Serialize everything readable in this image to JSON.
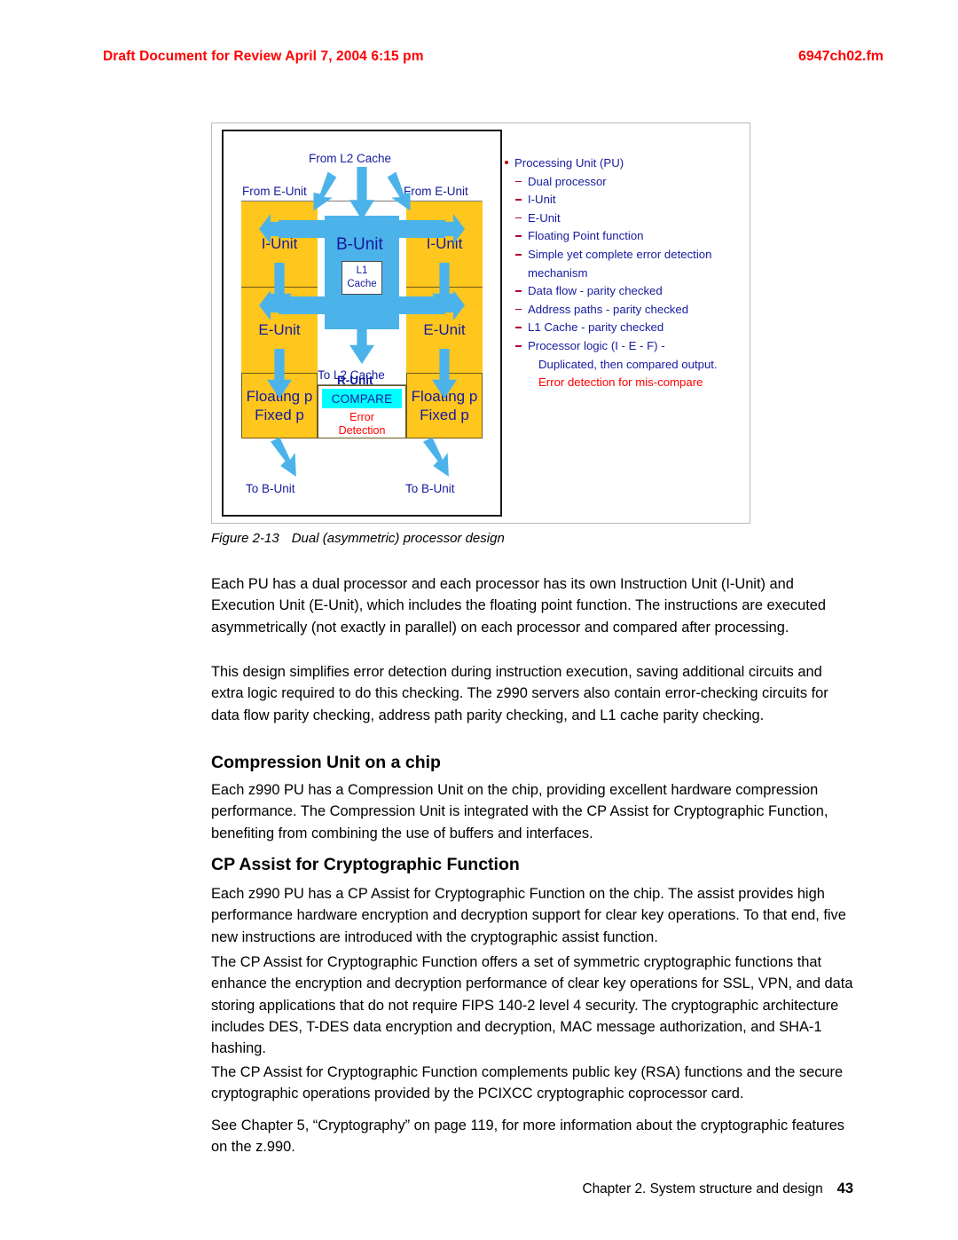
{
  "header": {
    "draft_notice": "Draft Document for Review April 7, 2004 6:15 pm",
    "file_name": "6947ch02.fm",
    "accent_color": "#ff0000"
  },
  "figure": {
    "caption_number": "Figure 2-13",
    "caption_text": "Dual (asymmetric) processor design",
    "colors": {
      "unit_fill": "#ffc61e",
      "arrow_blue": "#4cb3ea",
      "compare_fill": "#00ffff",
      "label_navy": "#151b9e",
      "error_red": "#ff0000"
    },
    "diagram": {
      "top_label": "From L2 Cache",
      "left_top_label": "From E-Unit",
      "right_top_label": "From E-Unit",
      "bus_unit_label": "B-Unit",
      "l1_cache_line1": "L1",
      "l1_cache_line2": "Cache",
      "left_iunit": "I-Unit",
      "right_iunit": "I-Unit",
      "left_eunit": "E-Unit",
      "right_eunit": "E-Unit",
      "to_l2_cache_label": "To L2 Cache",
      "left_fp_line1": "Floating p",
      "left_fp_line2": "Fixed p",
      "right_fp_line1": "Floating p",
      "right_fp_line2": "Fixed p",
      "r_unit_label": "R-Unit",
      "compare_label": "COMPARE",
      "error_line1": "Error",
      "error_line2": "Detection",
      "left_bottom_label": "To B-Unit",
      "right_bottom_label": "To B-Unit"
    },
    "bullets": [
      {
        "level": 0,
        "text": "Processing Unit (PU)",
        "red": false
      },
      {
        "level": 1,
        "text": "Dual processor",
        "red": false
      },
      {
        "level": 1,
        "text": "I-Unit",
        "red": false
      },
      {
        "level": 1,
        "text": "E-Unit",
        "red": false
      },
      {
        "level": 1,
        "text": "Floating Point function",
        "red": false
      },
      {
        "level": 1,
        "text": "Simple yet complete error detection mechanism",
        "red": false
      },
      {
        "level": 1,
        "text": "Data flow - parity checked",
        "red": false
      },
      {
        "level": 1,
        "text": "Address paths - parity checked",
        "red": false
      },
      {
        "level": 1,
        "text": "L1 Cache - parity checked",
        "red": false
      },
      {
        "level": 1,
        "text": "Processor logic (I - E - F) -",
        "red": false
      },
      {
        "level": 2,
        "text": "Duplicated, then compared output.",
        "red": false
      },
      {
        "level": 2,
        "text": "Error detection for mis-compare",
        "red": true
      }
    ]
  },
  "body": {
    "para1": "Each PU has a dual processor and each processor has its own Instruction Unit (I-Unit) and Execution Unit (E-Unit), which includes the floating point function. The instructions are executed asymmetrically (not exactly in parallel) on each processor and compared after processing.",
    "para2": "This design simplifies error detection during instruction execution, saving additional circuits and extra logic required to do this checking. The z990 servers also contain error-checking circuits for data flow parity checking, address path parity checking, and L1 cache parity checking.",
    "heading1": "Compression Unit on a chip",
    "para3": "Each z990 PU has a Compression Unit on the chip, providing excellent hardware compression performance. The Compression Unit is integrated with the CP Assist for Cryptographic Function, benefiting from combining the use of buffers and interfaces.",
    "heading2": "CP Assist for Cryptographic Function",
    "para4": "Each z990 PU has a CP Assist for Cryptographic Function on the chip. The assist provides high performance hardware encryption and decryption support for clear key operations. To that end, five new instructions are introduced with the cryptographic assist function.",
    "para5": "The CP Assist for Cryptographic Function offers a set of symmetric cryptographic functions that enhance the encryption and decryption performance of clear key operations for SSL, VPN, and data storing applications that do not require FIPS 140-2 level 4 security. The cryptographic architecture includes DES, T-DES data encryption and decryption, MAC message authorization, and SHA-1 hashing.",
    "para6": "The CP Assist for Cryptographic Function complements public key (RSA) functions and the secure cryptographic operations provided by the PCIXCC cryptographic coprocessor card.",
    "para7": "See Chapter 5, “Cryptography” on page 119, for more information about the cryptographic features on the z.990."
  },
  "footer": {
    "chapter_text": "Chapter 2. System structure and design",
    "page_number": "43"
  }
}
